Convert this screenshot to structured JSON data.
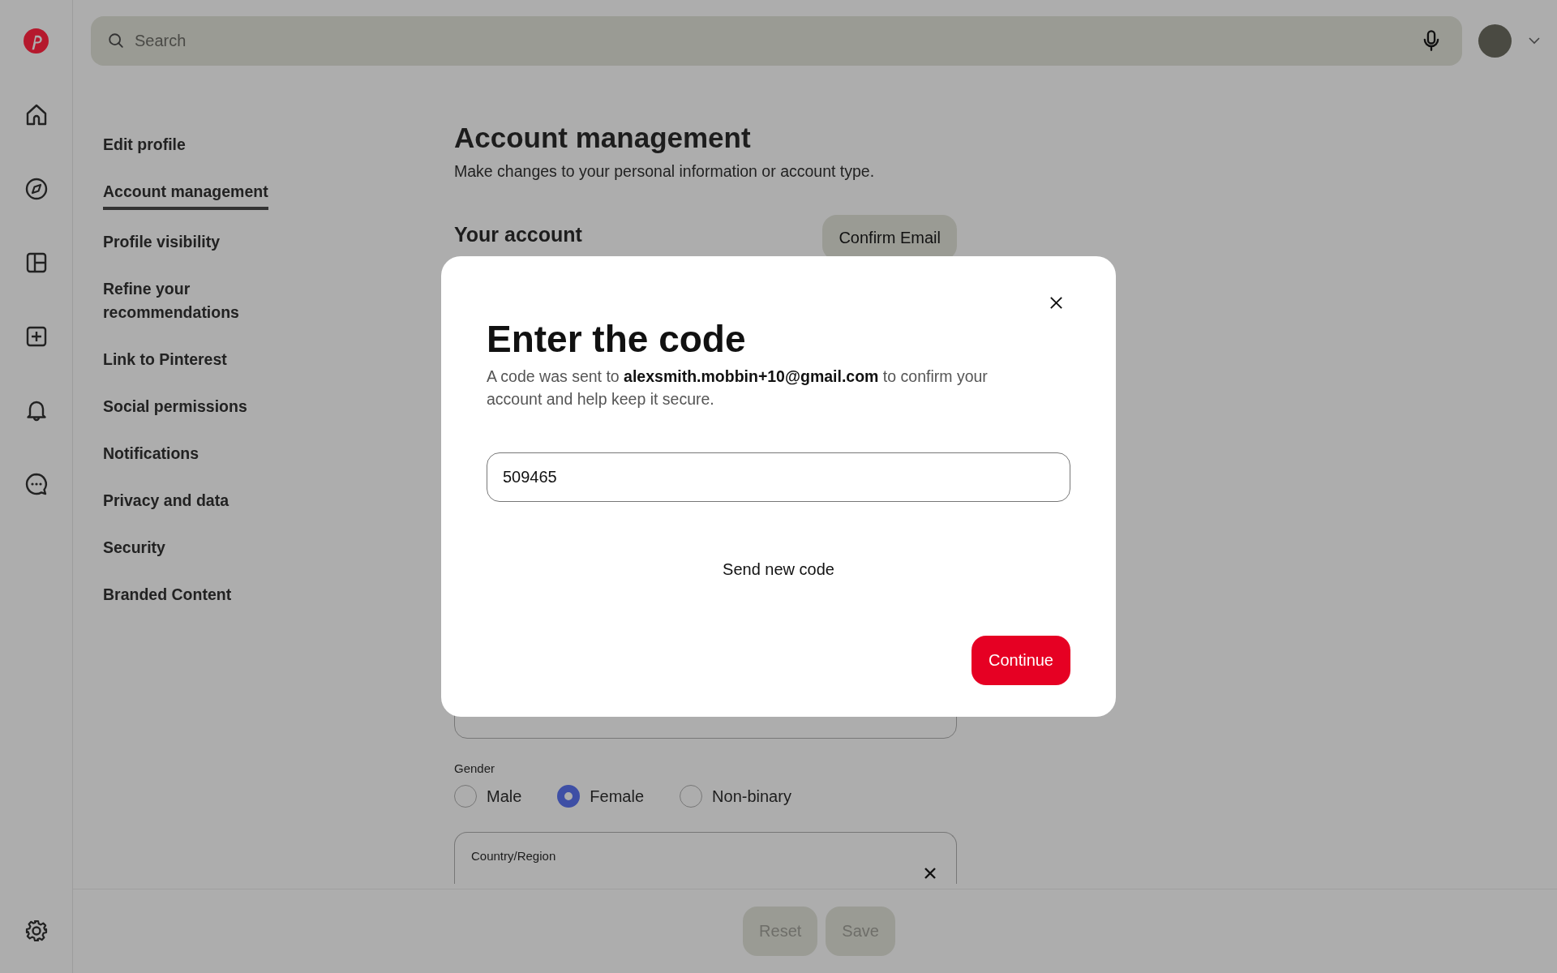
{
  "search": {
    "placeholder": "Search"
  },
  "settings_nav": [
    {
      "label": "Edit profile",
      "selected": false
    },
    {
      "label": "Account management",
      "selected": true
    },
    {
      "label": "Profile visibility",
      "selected": false
    },
    {
      "label": "Refine your recommendations",
      "selected": false
    },
    {
      "label": "Link to Pinterest",
      "selected": false
    },
    {
      "label": "Social permissions",
      "selected": false
    },
    {
      "label": "Notifications",
      "selected": false
    },
    {
      "label": "Privacy and data",
      "selected": false
    },
    {
      "label": "Security",
      "selected": false
    },
    {
      "label": "Branded Content",
      "selected": false
    }
  ],
  "page": {
    "title": "Account management",
    "subtitle": "Make changes to your personal information or account type.",
    "section_title": "Your account",
    "confirm_button": "Confirm Email"
  },
  "gender": {
    "label": "Gender",
    "options": [
      {
        "label": "Male",
        "selected": false
      },
      {
        "label": "Female",
        "selected": true
      },
      {
        "label": "Non-binary",
        "selected": false
      }
    ]
  },
  "country": {
    "label": "Country/Region"
  },
  "footer_buttons": [
    {
      "label": "Reset",
      "disabled": true
    },
    {
      "label": "Save",
      "disabled": true
    }
  ],
  "modal": {
    "title": "Enter the code",
    "message": "A code was sent to **alexsmith.mobbin+10@gmail.com** to confirm your account and help keep it secure.",
    "code_value": "509465",
    "resend_link": "Send new code",
    "continue_button": "Continue"
  }
}
